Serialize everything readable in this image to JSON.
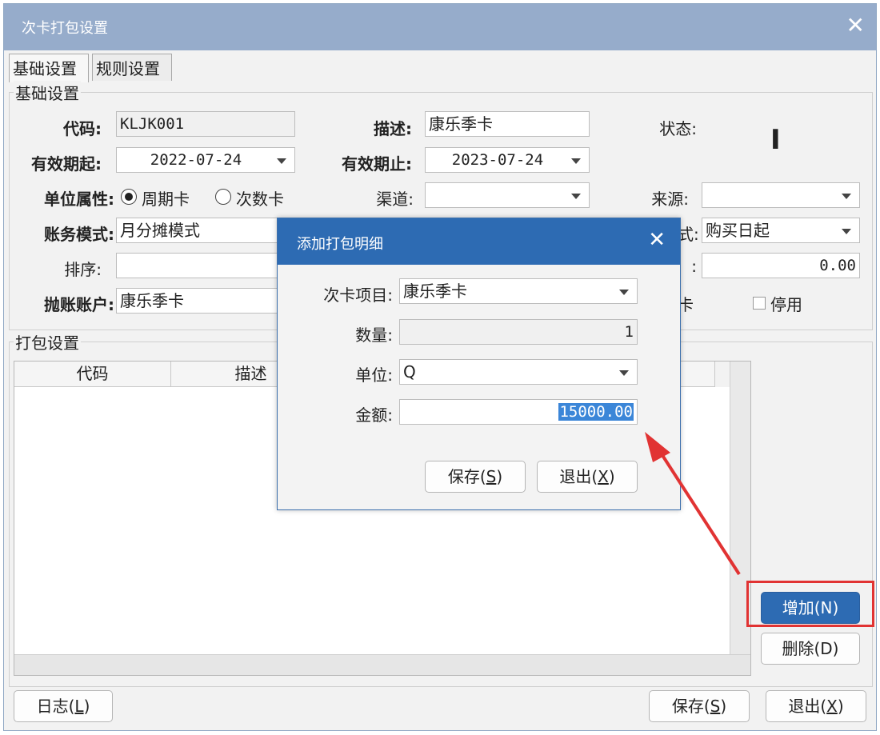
{
  "window": {
    "title": "次卡打包设置",
    "close": "✕"
  },
  "tabs": [
    {
      "label": "基础设置",
      "active": true
    },
    {
      "label": "规则设置",
      "active": false
    }
  ],
  "basic": {
    "group_label": "基础设置",
    "code_label": "代码:",
    "code_value": "KLJK001",
    "desc_label": "描述:",
    "desc_value": "康乐季卡",
    "status_label": "状态:",
    "status_value": "I",
    "start_label": "有效期起:",
    "start_value": "2022-07-24",
    "end_label": "有效期止:",
    "end_value": "2023-07-24",
    "unit_attr_label": "单位属性:",
    "radio_period": "周期卡",
    "radio_count": "次数卡",
    "channel_label": "渠道:",
    "channel_value": "",
    "source_label": "来源:",
    "source_value": "",
    "account_mode_label": "账务模式:",
    "account_mode_value": "月分摊模式",
    "partial_right_label": "式:",
    "partial_right_value": "购买日起",
    "sort_label": "排序:",
    "sort_value": "",
    "partial_colon": ":",
    "amount_right_value": "0.00",
    "post_account_label": "抛账账户:",
    "post_account_value": "康乐季卡",
    "partial_card": "卡",
    "disabled_label": "停用"
  },
  "package": {
    "group_label": "打包设置",
    "columns": [
      "代码",
      "描述"
    ],
    "add_button": "增加(N)",
    "add_key": "N",
    "delete_button": "删除(D)",
    "delete_key": "D"
  },
  "footer": {
    "log_button": "日志",
    "log_key": "L",
    "save_button": "保存",
    "save_key": "S",
    "exit_button": "退出",
    "exit_key": "X"
  },
  "dialog": {
    "title": "添加打包明细",
    "close": "✕",
    "item_label": "次卡项目:",
    "item_value": "康乐季卡",
    "qty_label": "数量:",
    "qty_value": "1",
    "unit_label": "单位:",
    "unit_value": "Q",
    "amount_label": "金额:",
    "amount_value": "15000.00",
    "save_button": "保存",
    "save_key": "S",
    "exit_button": "退出",
    "exit_key": "X"
  },
  "colors": {
    "titlebar": "#96accb",
    "dialog_title": "#2d6bb3",
    "primary_button": "#2d6bb3",
    "annotation": "#e13333"
  }
}
